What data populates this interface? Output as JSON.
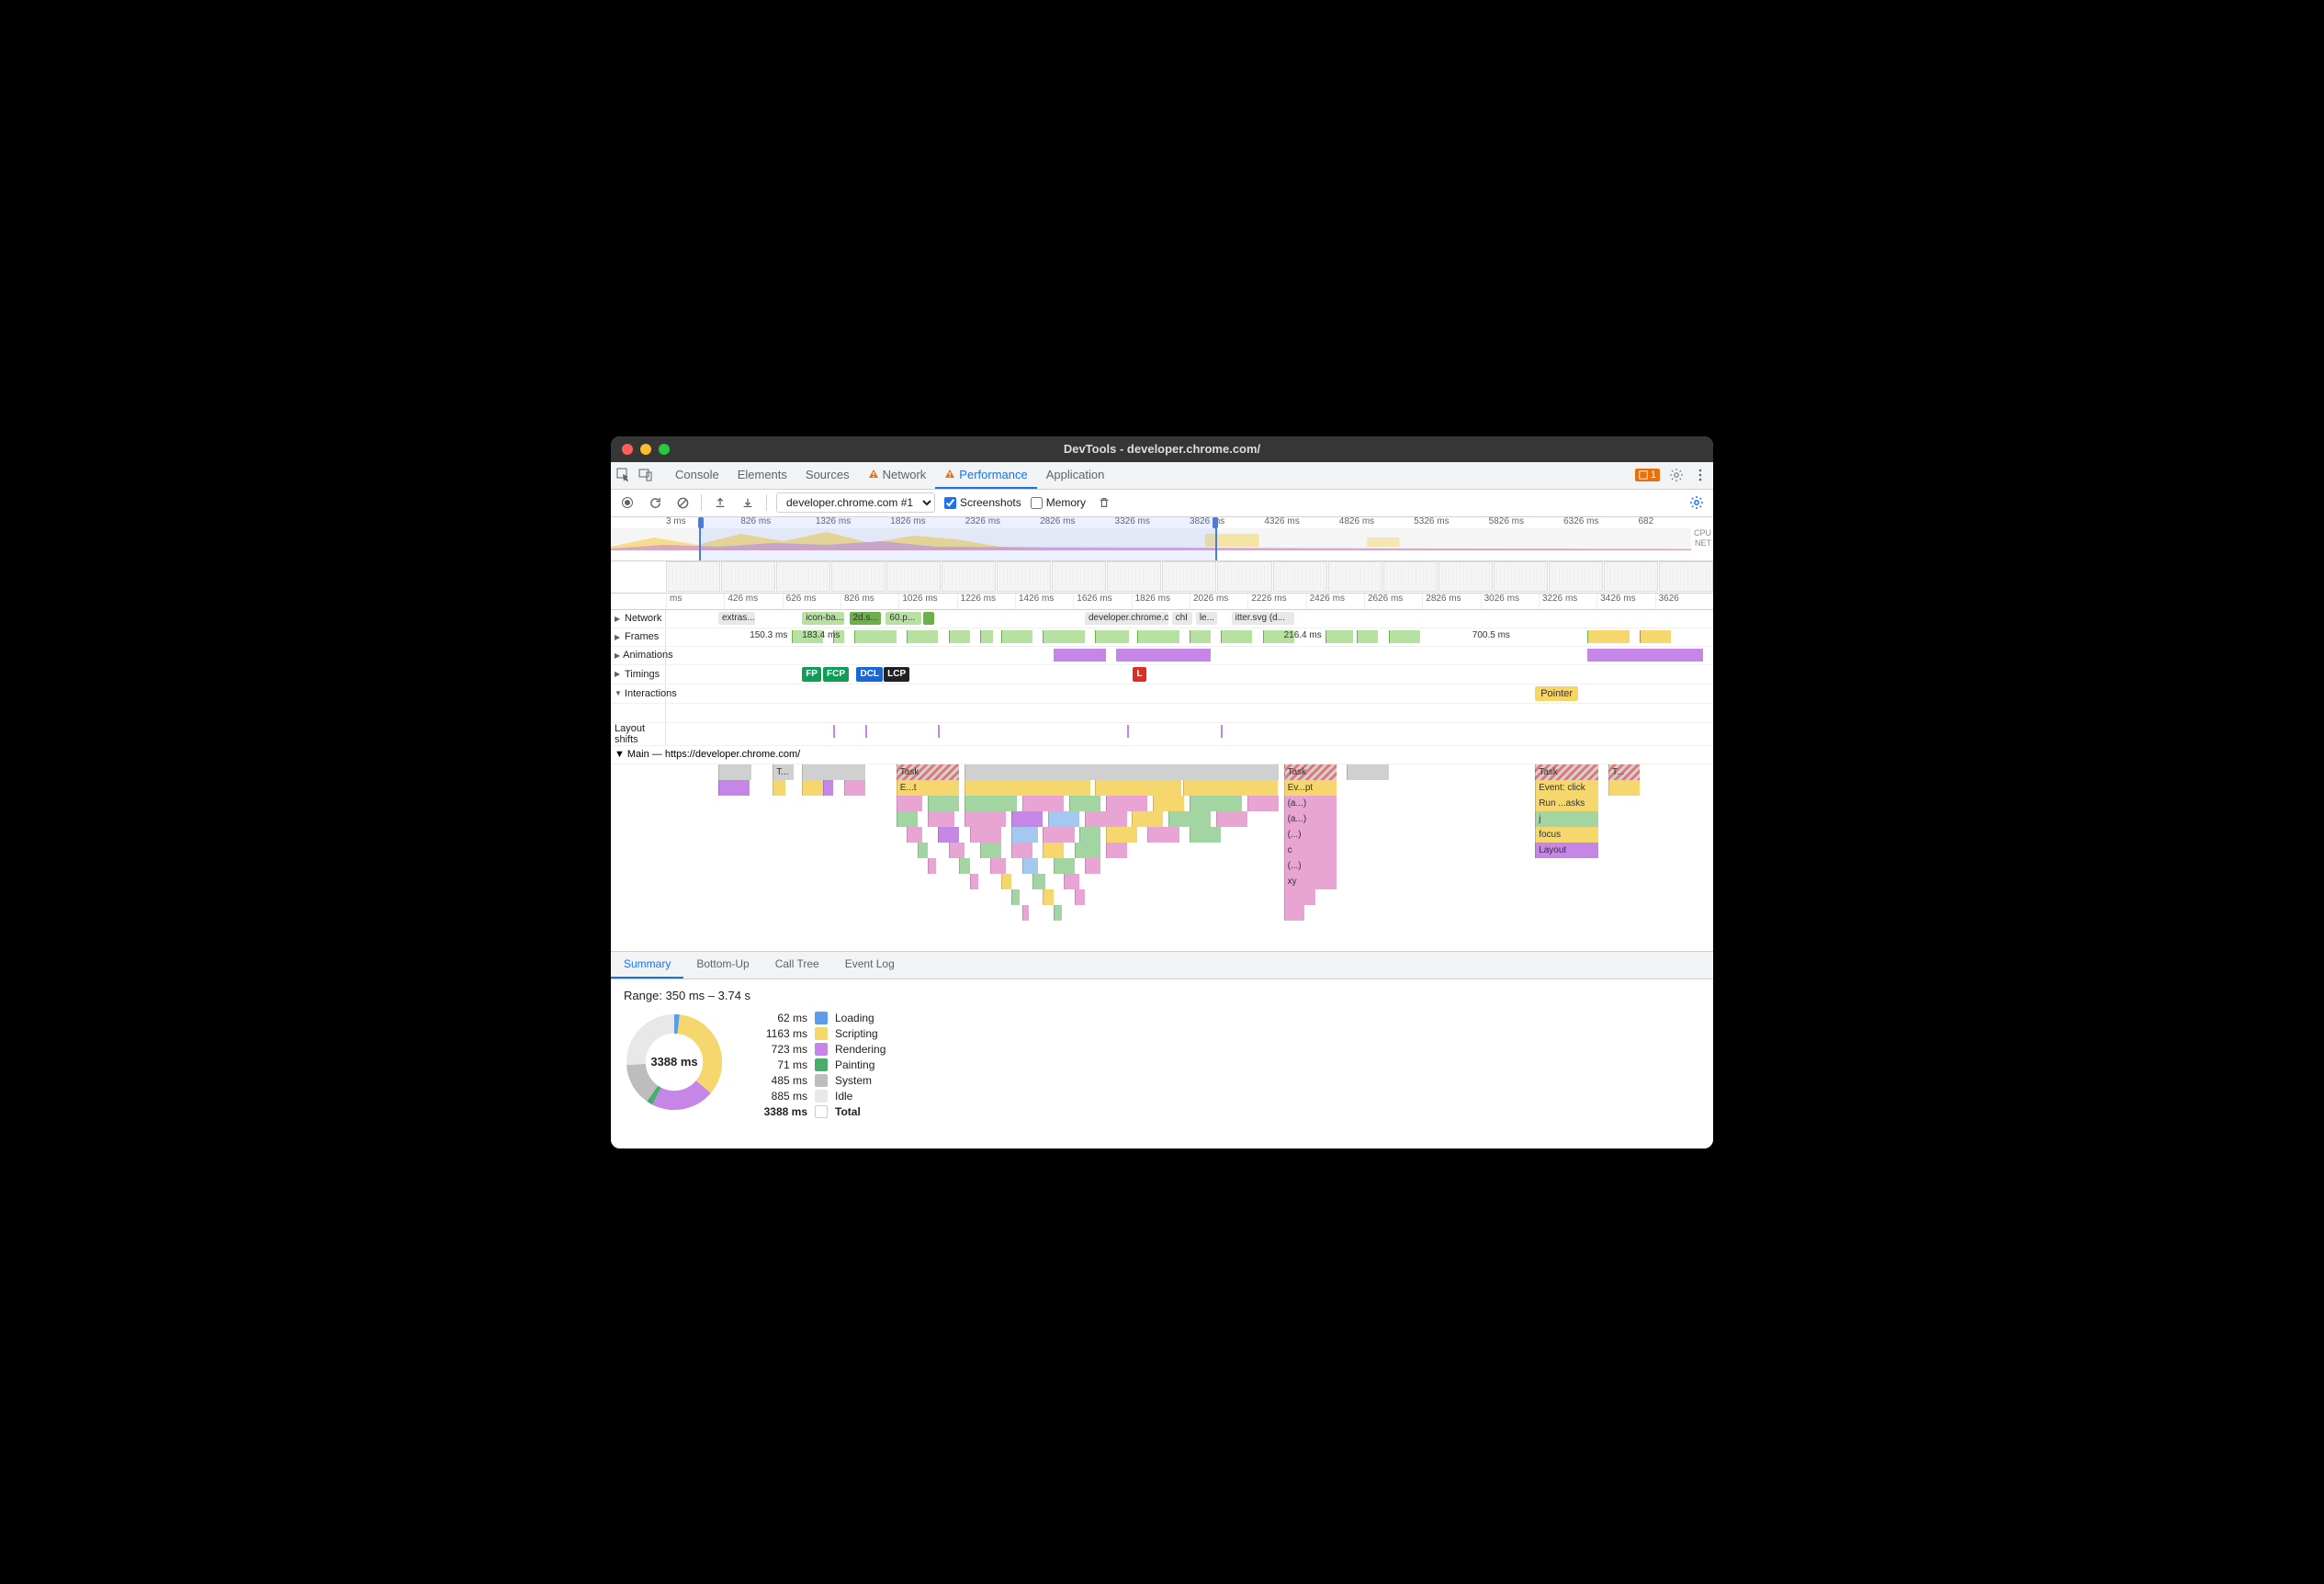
{
  "window": {
    "title": "DevTools - developer.chrome.com/"
  },
  "tabs": {
    "items": [
      "Console",
      "Elements",
      "Sources",
      "Network",
      "Performance",
      "Application"
    ],
    "active": "Performance",
    "warns": [
      "Network",
      "Performance"
    ],
    "issues_count": "1"
  },
  "toolbar": {
    "recording_label": "developer.chrome.com #1",
    "screenshots_label": "Screenshots",
    "memory_label": "Memory",
    "screenshots_checked": true,
    "memory_checked": false
  },
  "overview": {
    "ticks": [
      "3 ms",
      "826 ms",
      "1326 ms",
      "1826 ms",
      "2326 ms",
      "2826 ms",
      "3326 ms",
      "3826 ms",
      "4326 ms",
      "4826 ms",
      "5326 ms",
      "5826 ms",
      "6326 ms",
      "682"
    ],
    "right_labels": [
      "CPU",
      "NET"
    ],
    "sel_left_pct": 8,
    "sel_right_pct": 55
  },
  "timeline_ruler": [
    "ms",
    "426 ms",
    "626 ms",
    "826 ms",
    "1026 ms",
    "1226 ms",
    "1426 ms",
    "1626 ms",
    "1826 ms",
    "2026 ms",
    "2226 ms",
    "2426 ms",
    "2626 ms",
    "2826 ms",
    "3026 ms",
    "3226 ms",
    "3426 ms",
    "3626"
  ],
  "tracks": {
    "network": {
      "label": "Network",
      "items": [
        {
          "l": 5,
          "w": 3.5,
          "t": "extras....",
          "c": "#e8e8e8"
        },
        {
          "l": 13,
          "w": 4,
          "t": "icon-ba...",
          "c": "#b7e1a1"
        },
        {
          "l": 17.5,
          "w": 3,
          "t": "2d.s...",
          "c": "#6db04a"
        },
        {
          "l": 21,
          "w": 3.4,
          "t": "60.p...",
          "c": "#b7e1a1"
        },
        {
          "l": 24.6,
          "w": 1,
          "t": "",
          "c": "#6db04a"
        },
        {
          "l": 40,
          "w": 8,
          "t": "developer.chrome.c",
          "c": "#e8e8e8"
        },
        {
          "l": 48.3,
          "w": 2,
          "t": "chI",
          "c": "#e8e8e8"
        },
        {
          "l": 50.6,
          "w": 2,
          "t": "le...",
          "c": "#e8e8e8"
        },
        {
          "l": 54,
          "w": 6,
          "t": "itter.svg (d...",
          "c": "#e8e8e8"
        }
      ]
    },
    "frames": {
      "label": "Frames",
      "labels": [
        {
          "l": 8,
          "t": "150.3 ms"
        },
        {
          "l": 13,
          "t": "183.4 ms"
        },
        {
          "l": 59,
          "t": "216.4 ms"
        },
        {
          "l": 77,
          "t": "700.5 ms"
        }
      ],
      "blocks": [
        {
          "l": 12,
          "w": 3
        },
        {
          "l": 16,
          "w": 1
        },
        {
          "l": 18,
          "w": 4
        },
        {
          "l": 23,
          "w": 3
        },
        {
          "l": 27,
          "w": 2
        },
        {
          "l": 30,
          "w": 1.2
        },
        {
          "l": 32,
          "w": 3
        },
        {
          "l": 36,
          "w": 4
        },
        {
          "l": 41,
          "w": 3.2
        },
        {
          "l": 45,
          "w": 4
        },
        {
          "l": 50,
          "w": 2
        },
        {
          "l": 53,
          "w": 3
        },
        {
          "l": 57,
          "w": 3
        },
        {
          "l": 63,
          "w": 2.6
        },
        {
          "l": 66,
          "w": 2
        },
        {
          "l": 69,
          "w": 3
        }
      ]
    },
    "animations": {
      "label": "Animations",
      "blocks": [
        {
          "l": 37,
          "w": 5
        },
        {
          "l": 43,
          "w": 9
        },
        {
          "l": 88,
          "w": 11
        }
      ]
    },
    "timings": {
      "label": "Timings",
      "badges": [
        {
          "l": 13,
          "t": "FP",
          "c": "#0f9d58"
        },
        {
          "l": 15,
          "t": "FCP",
          "c": "#0f9d58"
        },
        {
          "l": 18.2,
          "t": "DCL",
          "c": "#1967d2"
        },
        {
          "l": 20.8,
          "t": "LCP",
          "c": "#202124"
        },
        {
          "l": 44.6,
          "t": "L",
          "c": "#d93025"
        }
      ]
    },
    "interactions": {
      "label": "Interactions",
      "badges": [
        {
          "l": 83,
          "t": "Pointer"
        }
      ]
    },
    "layout_shifts": {
      "label": "Layout shifts",
      "marks": [
        16,
        19,
        26,
        44,
        53
      ]
    },
    "main": {
      "label": "Main — https://developer.chrome.com/",
      "rows": [
        [
          {
            "l": 5,
            "w": 3.2,
            "t": "",
            "c": "#d0d0d0"
          },
          {
            "l": 10.2,
            "w": 2,
            "t": "T...",
            "c": "#d0d0d0"
          },
          {
            "l": 13,
            "w": 6,
            "t": "",
            "c": "#d0d0d0"
          },
          {
            "l": 22,
            "w": 6,
            "t": "Task",
            "c": "#d0d0d0",
            "stripe": true
          },
          {
            "l": 28.5,
            "w": 30,
            "t": "",
            "c": "#d0d0d0"
          },
          {
            "l": 59,
            "w": 5,
            "t": "Task",
            "c": "#d0d0d0",
            "stripe": true
          },
          {
            "l": 65,
            "w": 4,
            "t": "",
            "c": "#d0d0d0"
          },
          {
            "l": 83,
            "w": 6,
            "t": "Task",
            "c": "#d0d0d0",
            "stripe": true
          },
          {
            "l": 90,
            "w": 3,
            "t": "T...",
            "c": "#d0d0d0",
            "stripe": true
          }
        ],
        [
          {
            "l": 5,
            "w": 3,
            "t": "",
            "c": "#c586e8"
          },
          {
            "l": 10.2,
            "w": 1.2,
            "t": "",
            "c": "#f5d76e"
          },
          {
            "l": 13,
            "w": 2,
            "t": "",
            "c": "#f5d76e"
          },
          {
            "l": 15,
            "w": 1,
            "t": "",
            "c": "#c586e8"
          },
          {
            "l": 17,
            "w": 2,
            "t": "",
            "c": "#e8a5d4"
          },
          {
            "l": 22,
            "w": 6,
            "t": "E...t",
            "c": "#f5d76e"
          },
          {
            "l": 28.5,
            "w": 12,
            "t": "",
            "c": "#f5d76e"
          },
          {
            "l": 41,
            "w": 8.2,
            "t": "",
            "c": "#f5d76e"
          },
          {
            "l": 49.4,
            "w": 9,
            "t": "",
            "c": "#f5d76e"
          },
          {
            "l": 59,
            "w": 5,
            "t": "Ev...pt",
            "c": "#f5d76e"
          },
          {
            "l": 83,
            "w": 6,
            "t": "Event: click",
            "c": "#f5d76e"
          },
          {
            "l": 90,
            "w": 3,
            "t": "",
            "c": "#f5d76e"
          }
        ],
        [
          {
            "l": 22,
            "w": 2.5,
            "t": "",
            "c": "#e8a5d4"
          },
          {
            "l": 25,
            "w": 3,
            "t": "",
            "c": "#a2d5a2"
          },
          {
            "l": 28.5,
            "w": 5,
            "t": "",
            "c": "#a2d5a2"
          },
          {
            "l": 34,
            "w": 4,
            "t": "",
            "c": "#e8a5d4"
          },
          {
            "l": 38.5,
            "w": 3,
            "t": "",
            "c": "#a2d5a2"
          },
          {
            "l": 42,
            "w": 4,
            "t": "",
            "c": "#e8a5d4"
          },
          {
            "l": 46.5,
            "w": 3,
            "t": "",
            "c": "#f5d76e"
          },
          {
            "l": 50,
            "w": 5,
            "t": "",
            "c": "#a2d5a2"
          },
          {
            "l": 55.5,
            "w": 3,
            "t": "",
            "c": "#e8a5d4"
          },
          {
            "l": 59,
            "w": 5,
            "t": "(a...)",
            "c": "#e8a5d4"
          },
          {
            "l": 83,
            "w": 6,
            "t": "Run ...asks",
            "c": "#f5d76e"
          }
        ],
        [
          {
            "l": 22,
            "w": 2,
            "t": "",
            "c": "#a2d5a2"
          },
          {
            "l": 25,
            "w": 2.5,
            "t": "",
            "c": "#e8a5d4"
          },
          {
            "l": 28.5,
            "w": 4,
            "t": "",
            "c": "#e8a5d4"
          },
          {
            "l": 33,
            "w": 3,
            "t": "",
            "c": "#c586e8"
          },
          {
            "l": 36.5,
            "w": 3,
            "t": "",
            "c": "#a5c8f0"
          },
          {
            "l": 40,
            "w": 4,
            "t": "",
            "c": "#e8a5d4"
          },
          {
            "l": 44.5,
            "w": 3,
            "t": "",
            "c": "#f5d76e"
          },
          {
            "l": 48,
            "w": 4,
            "t": "",
            "c": "#a2d5a2"
          },
          {
            "l": 52.5,
            "w": 3,
            "t": "",
            "c": "#e8a5d4"
          },
          {
            "l": 59,
            "w": 5,
            "t": "(a...)",
            "c": "#e8a5d4"
          },
          {
            "l": 83,
            "w": 6,
            "t": "j",
            "c": "#a2d5a2"
          }
        ],
        [
          {
            "l": 23,
            "w": 1.5,
            "t": "",
            "c": "#e8a5d4"
          },
          {
            "l": 26,
            "w": 2,
            "t": "",
            "c": "#c586e8"
          },
          {
            "l": 29,
            "w": 3,
            "t": "",
            "c": "#e8a5d4"
          },
          {
            "l": 33,
            "w": 2.5,
            "t": "",
            "c": "#a5c8f0"
          },
          {
            "l": 36,
            "w": 3,
            "t": "",
            "c": "#e8a5d4"
          },
          {
            "l": 39.5,
            "w": 2,
            "t": "",
            "c": "#a2d5a2"
          },
          {
            "l": 42,
            "w": 3,
            "t": "",
            "c": "#f5d76e"
          },
          {
            "l": 46,
            "w": 3,
            "t": "",
            "c": "#e8a5d4"
          },
          {
            "l": 50,
            "w": 3,
            "t": "",
            "c": "#a2d5a2"
          },
          {
            "l": 59,
            "w": 5,
            "t": "(...)",
            "c": "#e8a5d4"
          },
          {
            "l": 83,
            "w": 6,
            "t": "focus",
            "c": "#f5d76e"
          }
        ],
        [
          {
            "l": 24,
            "w": 1,
            "t": "",
            "c": "#a2d5a2"
          },
          {
            "l": 27,
            "w": 1.5,
            "t": "",
            "c": "#e8a5d4"
          },
          {
            "l": 30,
            "w": 2,
            "t": "",
            "c": "#a2d5a2"
          },
          {
            "l": 33,
            "w": 2,
            "t": "",
            "c": "#e8a5d4"
          },
          {
            "l": 36,
            "w": 2,
            "t": "",
            "c": "#f5d76e"
          },
          {
            "l": 39,
            "w": 2.5,
            "t": "",
            "c": "#a2d5a2"
          },
          {
            "l": 42,
            "w": 2,
            "t": "",
            "c": "#e8a5d4"
          },
          {
            "l": 59,
            "w": 5,
            "t": "c",
            "c": "#e8a5d4"
          },
          {
            "l": 83,
            "w": 6,
            "t": "Layout",
            "c": "#c586e8"
          }
        ],
        [
          {
            "l": 25,
            "w": 0.8,
            "t": "",
            "c": "#e8a5d4"
          },
          {
            "l": 28,
            "w": 1,
            "t": "",
            "c": "#a2d5a2"
          },
          {
            "l": 31,
            "w": 1.5,
            "t": "",
            "c": "#e8a5d4"
          },
          {
            "l": 34,
            "w": 1.5,
            "t": "",
            "c": "#a5c8f0"
          },
          {
            "l": 37,
            "w": 2,
            "t": "",
            "c": "#a2d5a2"
          },
          {
            "l": 40,
            "w": 1.5,
            "t": "",
            "c": "#e8a5d4"
          },
          {
            "l": 59,
            "w": 5,
            "t": "(...)",
            "c": "#e8a5d4"
          }
        ],
        [
          {
            "l": 29,
            "w": 0.8,
            "t": "",
            "c": "#e8a5d4"
          },
          {
            "l": 32,
            "w": 1,
            "t": "",
            "c": "#f5d76e"
          },
          {
            "l": 35,
            "w": 1.2,
            "t": "",
            "c": "#a2d5a2"
          },
          {
            "l": 38,
            "w": 1.5,
            "t": "",
            "c": "#e8a5d4"
          },
          {
            "l": 59,
            "w": 5,
            "t": "xy",
            "c": "#e8a5d4"
          }
        ],
        [
          {
            "l": 33,
            "w": 0.8,
            "t": "",
            "c": "#a2d5a2"
          },
          {
            "l": 36,
            "w": 1,
            "t": "",
            "c": "#f5d76e"
          },
          {
            "l": 39,
            "w": 1,
            "t": "",
            "c": "#e8a5d4"
          },
          {
            "l": 59,
            "w": 3,
            "t": "",
            "c": "#e8a5d4"
          }
        ],
        [
          {
            "l": 34,
            "w": 0.6,
            "t": "",
            "c": "#e8a5d4"
          },
          {
            "l": 37,
            "w": 0.8,
            "t": "",
            "c": "#a2d5a2"
          },
          {
            "l": 59,
            "w": 2,
            "t": "",
            "c": "#e8a5d4"
          }
        ]
      ]
    }
  },
  "detail_tabs": {
    "items": [
      "Summary",
      "Bottom-Up",
      "Call Tree",
      "Event Log"
    ],
    "active": "Summary"
  },
  "summary": {
    "range": "Range: 350 ms – 3.74 s",
    "total": "3388 ms",
    "items": [
      {
        "val": "62 ms",
        "name": "Loading",
        "color": "#5d9cec"
      },
      {
        "val": "1163 ms",
        "name": "Scripting",
        "color": "#f5d76e"
      },
      {
        "val": "723 ms",
        "name": "Rendering",
        "color": "#c586e8"
      },
      {
        "val": "71 ms",
        "name": "Painting",
        "color": "#4aae6b"
      },
      {
        "val": "485 ms",
        "name": "System",
        "color": "#bdbdbd"
      },
      {
        "val": "885 ms",
        "name": "Idle",
        "color": "#e8e8e8"
      }
    ],
    "total_row": {
      "val": "3388 ms",
      "name": "Total"
    }
  },
  "chart_data": {
    "type": "pie",
    "title": "3388 ms",
    "series": [
      {
        "name": "Loading",
        "value": 62,
        "color": "#5d9cec"
      },
      {
        "name": "Scripting",
        "value": 1163,
        "color": "#f5d76e"
      },
      {
        "name": "Rendering",
        "value": 723,
        "color": "#c586e8"
      },
      {
        "name": "Painting",
        "value": 71,
        "color": "#4aae6b"
      },
      {
        "name": "System",
        "value": 485,
        "color": "#bdbdbd"
      },
      {
        "name": "Idle",
        "value": 885,
        "color": "#e8e8e8"
      }
    ]
  }
}
